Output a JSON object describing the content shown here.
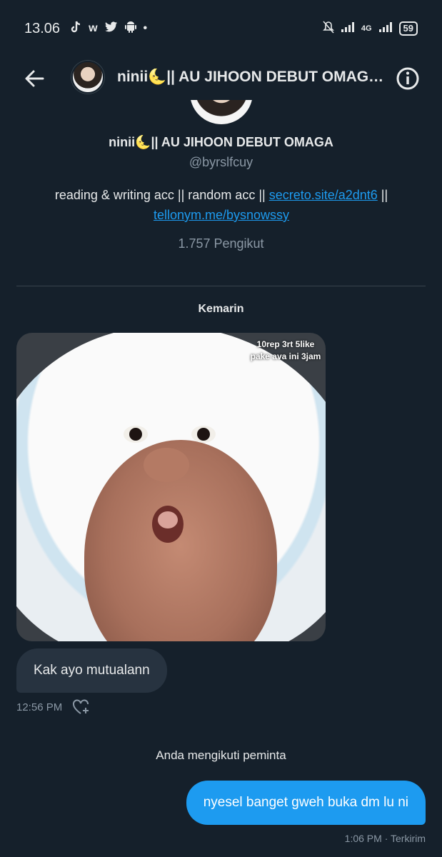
{
  "status_bar": {
    "time": "13.06",
    "app_icons": [
      "tiktok-icon",
      "w-icon",
      "twitter-icon",
      "android-icon"
    ],
    "app_icon_w": "w",
    "dot": "•",
    "network": "4G",
    "battery": "59"
  },
  "header": {
    "title": "ninii🌜|| AU JIHOON DEBUT OMAGA..."
  },
  "profile": {
    "name": "ninii🌜|| AU JIHOON DEBUT OMAGA",
    "handle": "@byrslfcuy",
    "bio_prefix": "reading & writing acc || random acc || ",
    "bio_link1": "secreto.site/a2dnt6",
    "bio_mid": " ||",
    "bio_link2": "tellonym.me/bysnowssy",
    "followers": "1.757 Pengikut"
  },
  "conversation": {
    "date_label": "Kemarin",
    "media_overlay_text": "10rep 3rt 5like pake ava ini 3jam",
    "incoming_message": "Kak ayo mutualann",
    "incoming_time": "12:56 PM",
    "system_notice": "Anda mengikuti peminta",
    "outgoing_message": "nyesel banget gweh buka dm lu ni",
    "outgoing_meta": "1:06 PM · Terkirim"
  },
  "colors": {
    "background": "#15202b",
    "accent": "#1d9bf0",
    "bubble_incoming": "#273340",
    "muted_text": "#8b98a5"
  }
}
